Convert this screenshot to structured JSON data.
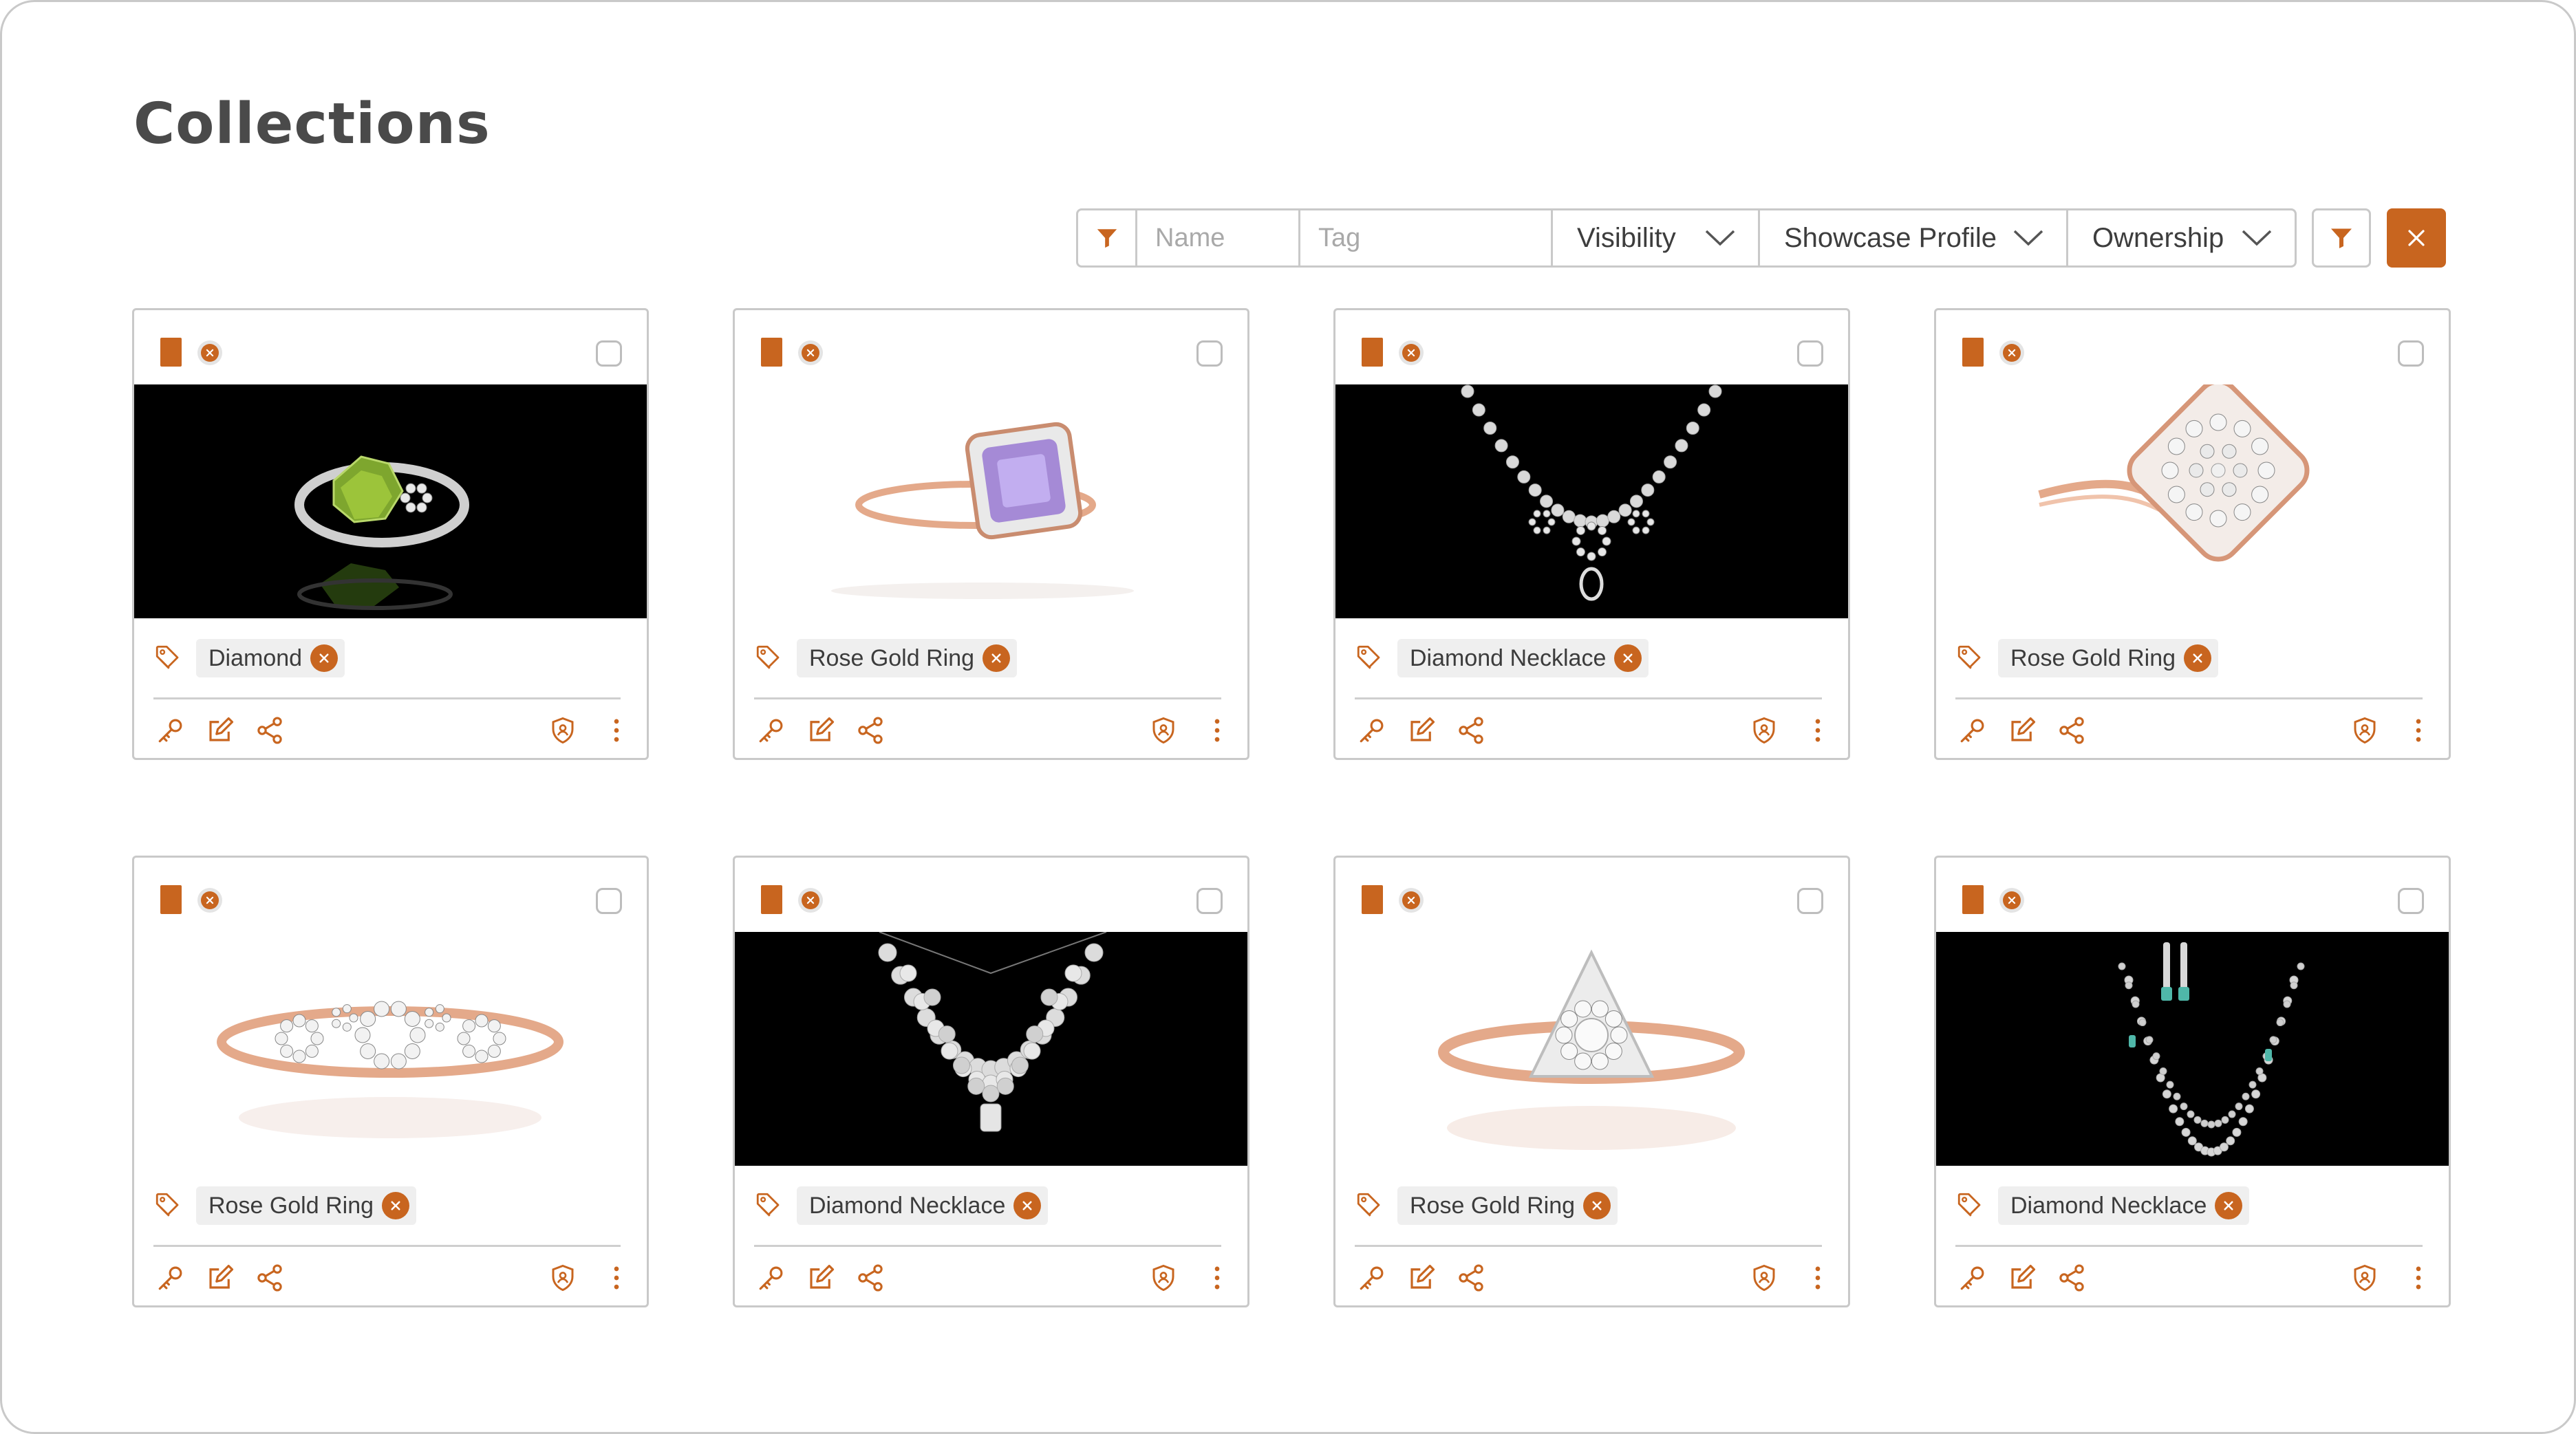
{
  "page": {
    "title": "Collections"
  },
  "filters": {
    "name_placeholder": "Name",
    "tag_placeholder": "Tag",
    "visibility_label": "Visibility",
    "showcase_label": "Showcase Profile",
    "ownership_label": "Ownership"
  },
  "colors": {
    "accent": "#c8651f",
    "border": "#c9c9c9",
    "chip_bg": "#efefef"
  },
  "icons": [
    "filter-icon",
    "chevron-down-icon",
    "close-icon",
    "bookmark-icon",
    "tag-icon",
    "key-icon",
    "edit-icon",
    "share-icon",
    "shield-icon",
    "more-vertical-icon",
    "checkbox-icon"
  ],
  "cards": [
    {
      "tag": "Diamond",
      "image": "green diamond ring on black"
    },
    {
      "tag": "Rose Gold Ring",
      "image": "rose gold ring with purple stone"
    },
    {
      "tag": "Diamond Necklace",
      "image": "diamond necklace on black"
    },
    {
      "tag": "Rose Gold Ring",
      "image": "rose gold diamond cluster ring"
    },
    {
      "tag": "Rose Gold Ring",
      "image": "rose gold ring with diamond clusters"
    },
    {
      "tag": "Diamond Necklace",
      "image": "diamond statement necklace on black"
    },
    {
      "tag": "Rose Gold Ring",
      "image": "rose gold triangle diamond ring"
    },
    {
      "tag": "Diamond Necklace",
      "image": "layered diamond necklace with earrings on black"
    }
  ]
}
